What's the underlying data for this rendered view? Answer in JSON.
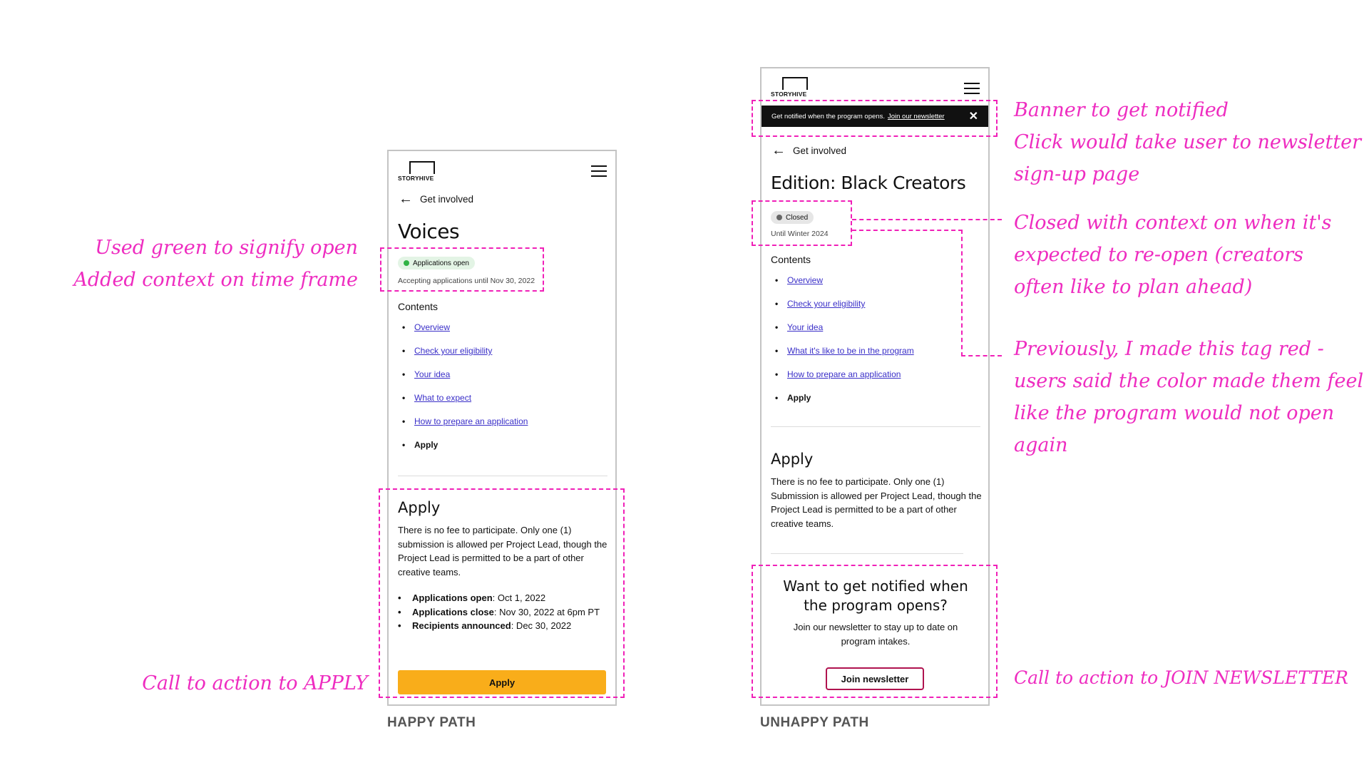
{
  "happy": {
    "logo": "STORYHIVE",
    "back_label": "Get involved",
    "title": "Voices",
    "status_pill": "Applications open",
    "status_context": "Accepting applications until Nov 30, 2022",
    "contents_heading": "Contents",
    "toc": [
      "Overview",
      "Check your eligibility",
      "Your idea",
      "What to expect",
      "How to prepare an application",
      "Apply"
    ],
    "apply_heading": "Apply",
    "apply_text": "There is no fee to participate. Only one (1) submission is allowed per Project Lead, though the Project Lead is permitted to be a part of other creative teams.",
    "dates": [
      {
        "label": "Applications open",
        "value": ": Oct 1, 2022"
      },
      {
        "label": "Applications close",
        "value": ": Nov 30, 2022 at 6pm PT"
      },
      {
        "label": "Recipients announced",
        "value": ": Dec 30, 2022"
      }
    ],
    "apply_button": "Apply",
    "path_label": "HAPPY PATH"
  },
  "unhappy": {
    "logo": "STORYHIVE",
    "banner_text": "Get notified when the program opens.",
    "banner_link": "Join our newsletter",
    "back_label": "Get involved",
    "title": "Edition: Black Creators",
    "status_pill": "Closed",
    "status_context": "Until Winter 2024",
    "contents_heading": "Contents",
    "toc": [
      "Overview",
      "Check your eligibility",
      "Your idea",
      "What it's like to be in the program",
      "How to prepare an application",
      "Apply"
    ],
    "apply_heading": "Apply",
    "apply_text": "There is no fee to participate. Only one (1) Submission is allowed per Project Lead, though the Project Lead is permitted to be a part of other creative teams.",
    "notify_heading": "Want to get notified when the program opens?",
    "notify_text": "Join our newsletter to stay up to date on program intakes.",
    "newsletter_button": "Join newsletter",
    "path_label": "UNHAPPY PATH"
  },
  "annotations": {
    "left_open_1": "Used green to signify open",
    "left_open_2": "Added context on time frame",
    "left_cta": "Call to action to APPLY",
    "right_banner_1": "Banner to get notified",
    "right_banner_2": "Click would take user to newsletter",
    "right_banner_3": "sign-up page",
    "right_closed_1": "Closed with context on when it's",
    "right_closed_2": "expected to re-open (creators",
    "right_closed_3": "often like to plan ahead)",
    "right_red_1": "Previously, I made this tag red -",
    "right_red_2": "users said the color made them feel",
    "right_red_3": "like the program would not open",
    "right_red_4": "again",
    "right_cta": "Call to action to JOIN NEWSLETTER"
  },
  "colors": {
    "annotation": "#f020b8",
    "open_green": "#2fb344",
    "closed_grey": "#666666",
    "apply_button": "#f9ad1a",
    "link": "#3a2fc8",
    "newsletter_border": "#b0134f"
  }
}
